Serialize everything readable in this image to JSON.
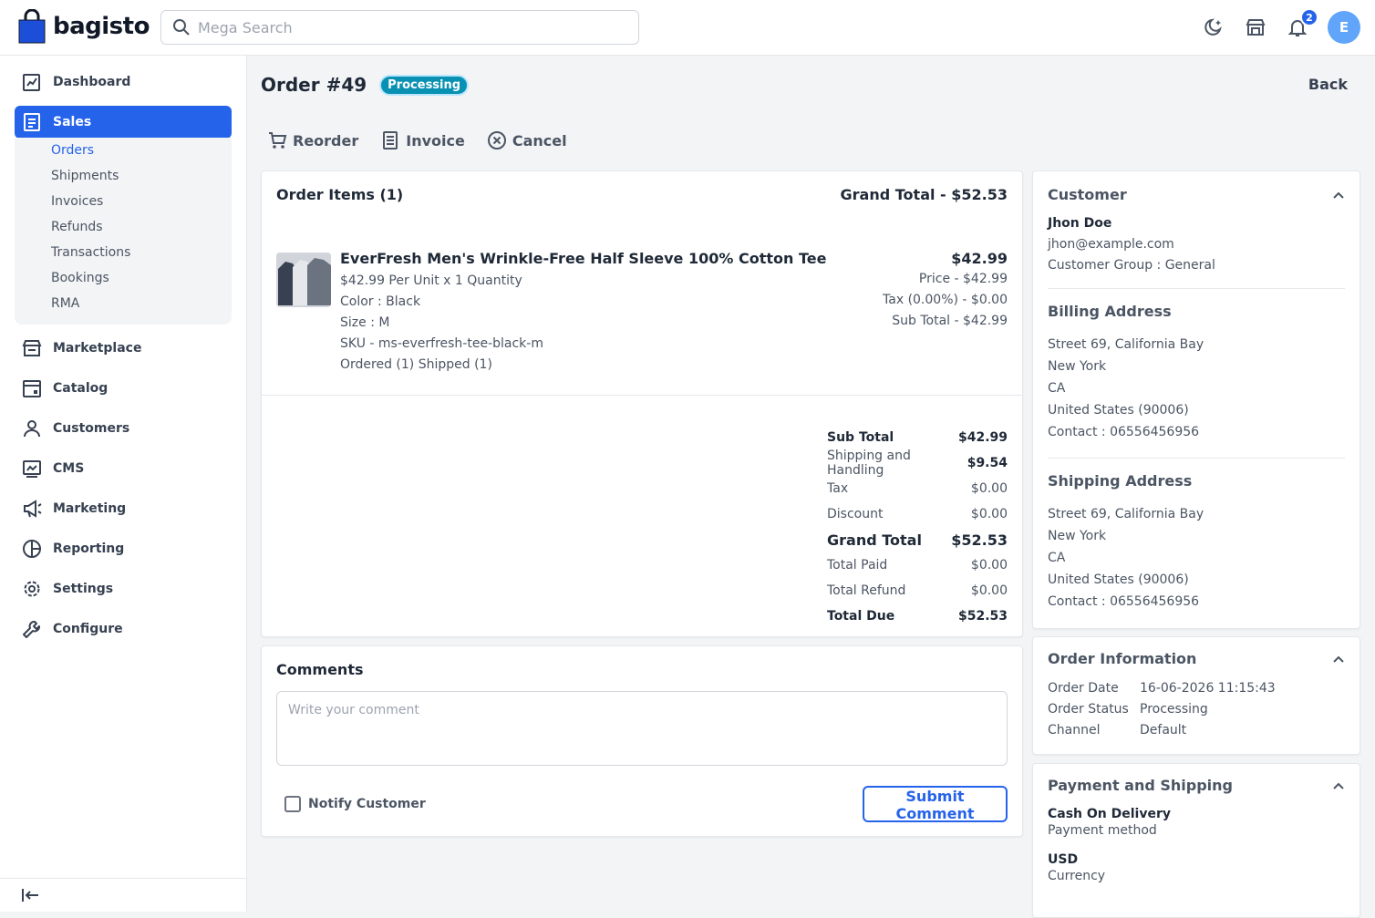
{
  "app": {
    "brand": "bagisto"
  },
  "search": {
    "placeholder": "Mega Search"
  },
  "notifications": {
    "count": "2"
  },
  "user": {
    "initial": "E"
  },
  "sidebar": {
    "items": [
      {
        "label": "Dashboard"
      },
      {
        "label": "Sales"
      },
      {
        "label": "Marketplace"
      },
      {
        "label": "Catalog"
      },
      {
        "label": "Customers"
      },
      {
        "label": "CMS"
      },
      {
        "label": "Marketing"
      },
      {
        "label": "Reporting"
      },
      {
        "label": "Settings"
      },
      {
        "label": "Configure"
      }
    ],
    "sales_sub": [
      "Orders",
      "Shipments",
      "Invoices",
      "Refunds",
      "Transactions",
      "Bookings",
      "RMA"
    ]
  },
  "order": {
    "title": "Order #49",
    "status": "Processing",
    "back": "Back",
    "actions": {
      "reorder": "Reorder",
      "invoice": "Invoice",
      "cancel": "Cancel"
    }
  },
  "items_card": {
    "title": "Order Items (1)",
    "grand_total": "Grand Total - $52.53",
    "product": {
      "name": "EverFresh Men's Wrinkle-Free Half Sleeve 100% Cotton Tee",
      "unit_line": "$42.99 Per Unit x 1 Quantity",
      "color": "Color : Black",
      "size": "Size : M",
      "sku": "SKU - ms-everfresh-tee-black-m",
      "ordered": "Ordered (1) Shipped (1)",
      "total": "$42.99",
      "price": "Price - $42.99",
      "tax": "Tax (0.00%) - $0.00",
      "subtotal": "Sub Total - $42.99"
    },
    "totals": [
      {
        "label": "Sub Total",
        "value": "$42.99"
      },
      {
        "label": "Shipping and Handling",
        "value": "$9.54"
      },
      {
        "label": "Tax",
        "value": "$0.00"
      },
      {
        "label": "Discount",
        "value": "$0.00"
      },
      {
        "label": "Grand Total",
        "value": "$52.53"
      },
      {
        "label": "Total Paid",
        "value": "$0.00"
      },
      {
        "label": "Total Refund",
        "value": "$0.00"
      },
      {
        "label": "Total Due",
        "value": "$52.53"
      }
    ]
  },
  "comments": {
    "title": "Comments",
    "placeholder": "Write your comment",
    "notify": "Notify Customer",
    "submit": "Submit Comment"
  },
  "customer": {
    "title": "Customer",
    "name": "Jhon Doe",
    "email": "jhon@example.com",
    "group": "Customer Group : General"
  },
  "billing": {
    "title": "Billing Address",
    "lines": [
      "Street 69, California Bay",
      "New York",
      "CA",
      "United States (90006)",
      "Contact : 06556456956"
    ]
  },
  "shipping": {
    "title": "Shipping Address",
    "lines": [
      "Street 69, California Bay",
      "New York",
      "CA",
      "United States (90006)",
      "Contact : 06556456956"
    ]
  },
  "order_info": {
    "title": "Order Information",
    "rows": [
      {
        "key": "Order Date",
        "value": "16-06-2026 11:15:43"
      },
      {
        "key": "Order Status",
        "value": "Processing"
      },
      {
        "key": "Channel",
        "value": "Default"
      }
    ]
  },
  "payment": {
    "title": "Payment and Shipping",
    "method": "Cash On Delivery",
    "method_label": "Payment method",
    "currency": "USD",
    "currency_label": "Currency"
  },
  "colors": {
    "primary": "#2563eb",
    "status": "#0891b2"
  }
}
